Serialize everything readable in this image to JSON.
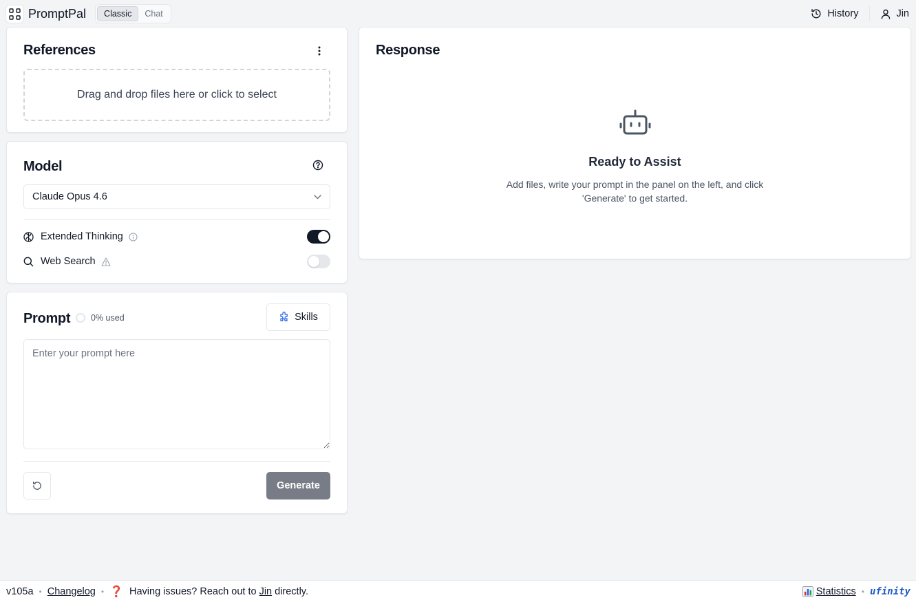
{
  "header": {
    "brand": "PromptPal",
    "modes": [
      {
        "label": "Classic",
        "active": true
      },
      {
        "label": "Chat",
        "active": false
      }
    ],
    "history_label": "History",
    "user_label": "Jin"
  },
  "references": {
    "title": "References",
    "dropzone_text": "Drag and drop files here or click to select"
  },
  "model": {
    "title": "Model",
    "selected": "Claude Opus 4.6",
    "options": [
      {
        "label": "Extended Thinking",
        "enabled": true
      },
      {
        "label": "Web Search",
        "enabled": false
      }
    ]
  },
  "prompt": {
    "title": "Prompt",
    "usage": "0% used",
    "skills_label": "Skills",
    "placeholder": "Enter your prompt here",
    "value": "",
    "generate_label": "Generate"
  },
  "response": {
    "title": "Response",
    "empty_title": "Ready to Assist",
    "empty_line1": "Add files, write your prompt in the panel on the left, and click",
    "empty_line2": "'Generate' to get started."
  },
  "footer": {
    "version": "v105a",
    "changelog": "Changelog",
    "issues_prefix": "Having issues? Reach out to",
    "issues_contact": "Jin",
    "issues_suffix": "directly.",
    "statistics": "Statistics",
    "company": "ufinity"
  },
  "colors": {
    "accent_dark": "#111827",
    "generate_bg": "#787c86",
    "skills_icon": "#2563eb",
    "company_brand": "#1e5bc6"
  }
}
